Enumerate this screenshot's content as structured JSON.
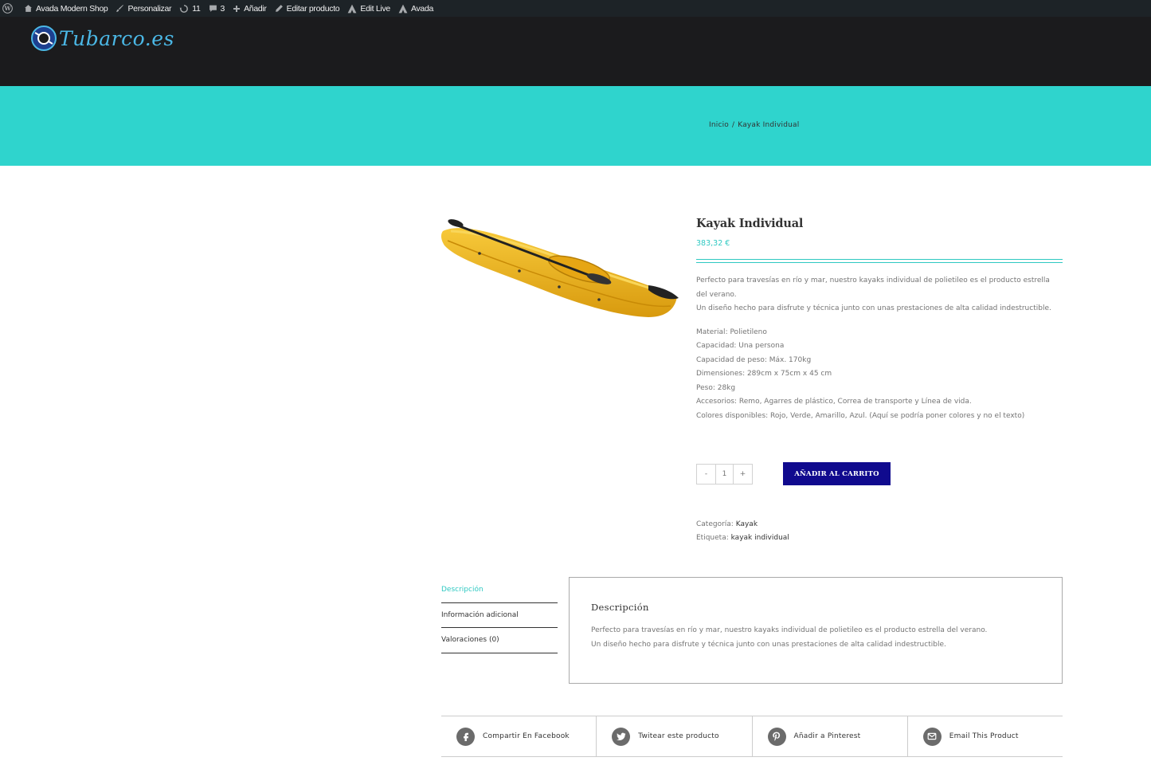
{
  "adminbar": {
    "items": [
      "Avada Modern Shop",
      "Personalizar",
      "11",
      "3",
      "Añadir",
      "Editar producto",
      "Edit Live",
      "Avada"
    ]
  },
  "header": {
    "logo_text": "Tubarco.es"
  },
  "breadcrumb": {
    "home": "Inicio",
    "separator": "/",
    "current": "Kayak Individual"
  },
  "product": {
    "title": "Kayak Individual",
    "price": "383,32 €",
    "short_desc": [
      "Perfecto para travesías en río y mar, nuestro kayaks individual de polietileo es el producto estrella del verano.",
      "Un diseño hecho para disfrute y técnica junto con unas prestaciones de alta calidad indestructible."
    ],
    "specs": [
      "Material: Polietileno",
      "Capacidad: Una persona",
      "Capacidad de peso: Máx. 170kg",
      "Dimensiones: 289cm x 75cm x 45 cm",
      "Peso: 28kg",
      "Accesorios: Remo, Agarres de plástico, Correa de transporte y Línea de vida.",
      "Colores disponibles: Rojo, Verde, Amarillo, Azul. (Aquí se podría poner colores y no el texto)"
    ],
    "quantity": {
      "minus": "-",
      "value": "1",
      "plus": "+"
    },
    "add_to_cart": "AÑADIR AL CARRITO",
    "meta": {
      "category_label": "Categoría:",
      "category_value": "Kayak",
      "tag_label": "Etiqueta:",
      "tag_value": "kayak individual"
    }
  },
  "tabs": {
    "items": [
      "Descripción",
      "Información adicional",
      "Valoraciones (0)"
    ],
    "panel_title": "Descripción",
    "panel_text": [
      "Perfecto para travesías en río y mar, nuestro kayaks individual de polietileo es el producto estrella del verano.",
      "Un diseño hecho para disfrute y técnica junto con unas prestaciones de alta calidad indestructible."
    ]
  },
  "share": {
    "facebook": "Compartir En Facebook",
    "twitter": "Twitear este producto",
    "pinterest": "Añadir a Pinterest",
    "email": "Email This Product"
  },
  "colors": {
    "accent": "#2fd4cd",
    "button": "#100a8e",
    "header_bg": "#1b1b1d",
    "adminbar_bg": "#1d2327",
    "kayak": "#f2b21b"
  }
}
